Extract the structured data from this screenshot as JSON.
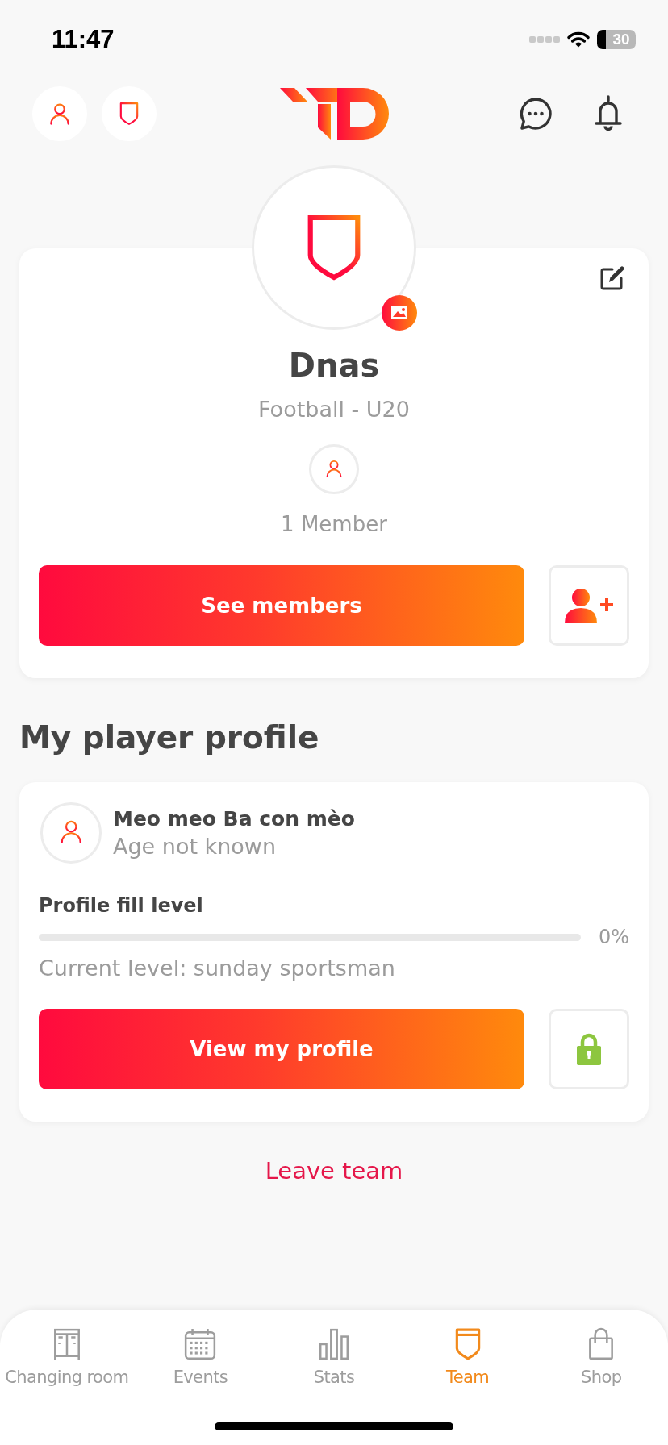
{
  "status_bar": {
    "time": "11:47",
    "battery": "30"
  },
  "team": {
    "name": "Dnas",
    "subtitle": "Football - U20",
    "members": "1 Member",
    "button": "See members"
  },
  "player_profile": {
    "heading": "My player profile",
    "name": "Meo meo Ba con mèo",
    "age": "Age not known",
    "fill_label": "Profile fill level",
    "level": 0,
    "percent": "0%",
    "current_level": "Current level: sunday sportsman",
    "button": "View my profile"
  },
  "leave_team": "Leave team",
  "tab_bar": [
    {
      "kind": "locker",
      "label": "Changing room",
      "selected": false
    },
    {
      "kind": "calendar",
      "label": "Events",
      "selected": false
    },
    {
      "kind": "chart",
      "label": "Stats",
      "selected": false
    },
    {
      "kind": "shield",
      "label": "Team",
      "selected": true
    },
    {
      "kind": "bag",
      "label": "Shop",
      "selected": false
    }
  ]
}
